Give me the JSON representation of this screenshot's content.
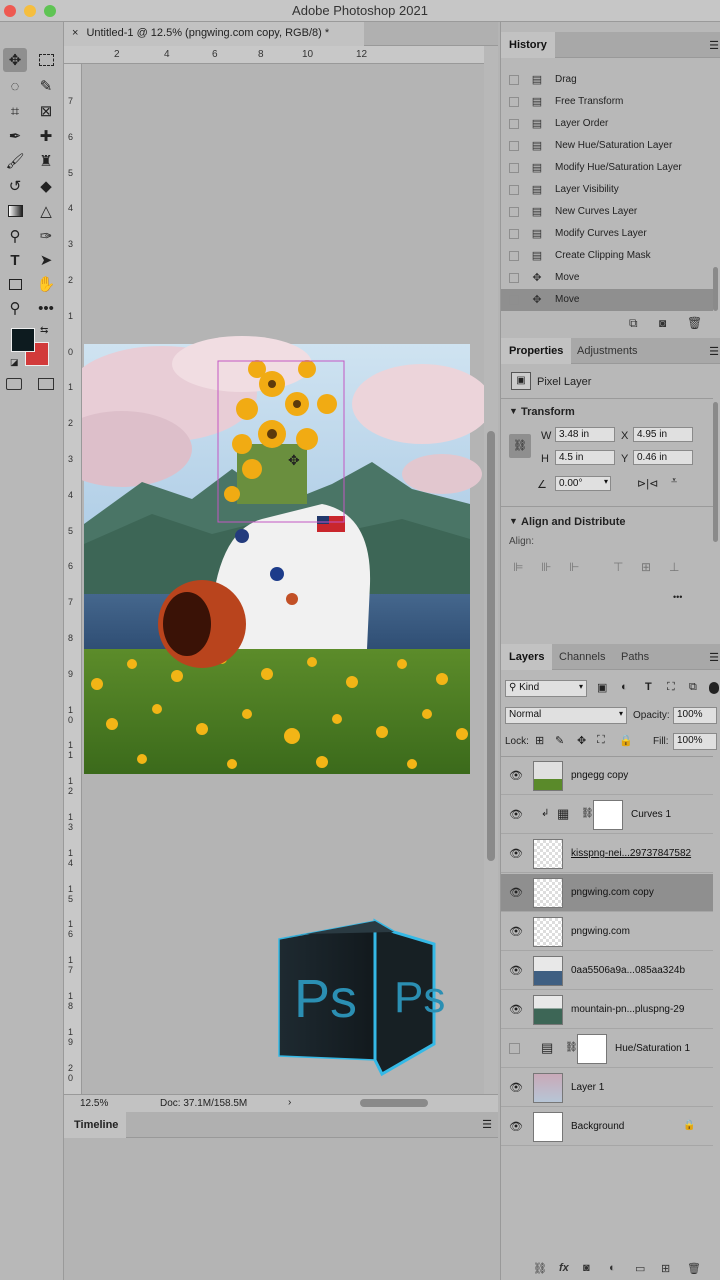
{
  "window": {
    "title": "Adobe Photoshop 2021"
  },
  "colors": {
    "foreground": "#0d1b1f",
    "background": "#d23a3a",
    "accent_cyan": "#35b9e6"
  },
  "document_tab": {
    "title": "Untitled-1 @ 12.5% (pngwing.com copy, RGB/8) *",
    "close": "×"
  },
  "rulers": {
    "top": [
      "2",
      "4",
      "6",
      "8",
      "10",
      "12"
    ],
    "left": [
      "7",
      "6",
      "5",
      "4",
      "3",
      "2",
      "1",
      "0",
      "1",
      "2",
      "3",
      "4",
      "5",
      "6",
      "7",
      "8",
      "9",
      "1\n0",
      "1\n1",
      "1\n2",
      "1\n3",
      "1\n4",
      "1\n5",
      "1\n6",
      "1\n7",
      "1\n8",
      "1\n9",
      "2\n0"
    ]
  },
  "status": {
    "zoom": "12.5%",
    "doc": "Doc: 37.1M/158.5M",
    "arrow": "›"
  },
  "timeline": {
    "label": "Timeline"
  },
  "history": {
    "tab": "History",
    "items": [
      {
        "label": "Drag",
        "icon": "▤"
      },
      {
        "label": "Free Transform",
        "icon": "▤"
      },
      {
        "label": "Layer Order",
        "icon": "▤"
      },
      {
        "label": "New Hue/Saturation Layer",
        "icon": "▤"
      },
      {
        "label": "Modify Hue/Saturation Layer",
        "icon": "▤"
      },
      {
        "label": "Layer Visibility",
        "icon": "▤"
      },
      {
        "label": "New Curves Layer",
        "icon": "▤"
      },
      {
        "label": "Modify Curves Layer",
        "icon": "▤"
      },
      {
        "label": "Create Clipping Mask",
        "icon": "▤"
      },
      {
        "label": "Move",
        "icon": "✥"
      },
      {
        "label": "Move",
        "icon": "✥"
      }
    ]
  },
  "properties": {
    "tabs": [
      "Properties",
      "Adjustments"
    ],
    "kind": "Pixel Layer",
    "transform": {
      "title": "Transform",
      "w_label": "W",
      "w": "3.48 in",
      "x_label": "X",
      "x": "4.95 in",
      "h_label": "H",
      "h": "4.5 in",
      "y_label": "Y",
      "y": "0.46 in",
      "angle": "0.00°"
    },
    "align": {
      "title": "Align and Distribute",
      "label": "Align:",
      "more": "•••"
    }
  },
  "layers": {
    "tabs": [
      "Layers",
      "Channels",
      "Paths"
    ],
    "filter": "Kind",
    "blend": "Normal",
    "opacity_label": "Opacity:",
    "opacity": "100%",
    "lock_label": "Lock:",
    "fill_label": "Fill:",
    "fill": "100%",
    "items": [
      {
        "name": "pngegg copy",
        "visible": true
      },
      {
        "name": "Curves 1",
        "visible": true
      },
      {
        "name": "kisspng-nei...29737847582",
        "visible": true
      },
      {
        "name": "pngwing.com copy",
        "visible": true
      },
      {
        "name": "pngwing.com",
        "visible": true
      },
      {
        "name": "0aa5506a9a...085aa324b",
        "visible": true
      },
      {
        "name": "mountain-pn...pluspng-29",
        "visible": true
      },
      {
        "name": "Hue/Saturation 1",
        "visible": false
      },
      {
        "name": "Layer 1",
        "visible": true
      },
      {
        "name": "Background",
        "visible": true
      }
    ]
  },
  "ps_logo": {
    "text": "Ps"
  }
}
